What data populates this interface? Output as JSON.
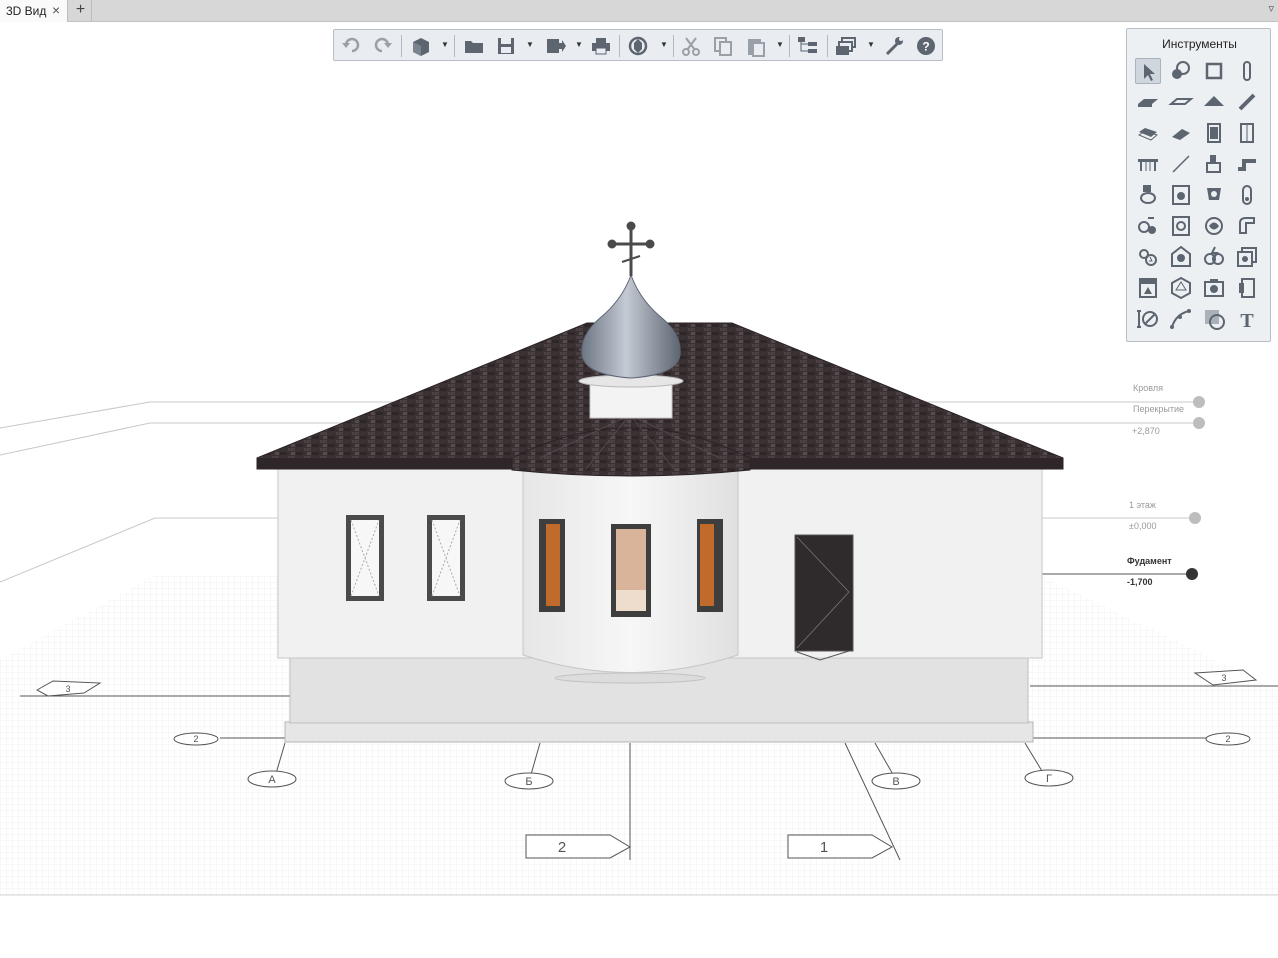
{
  "tabs": [
    {
      "label": "3D Вид",
      "close": "×"
    }
  ],
  "tab_add": "+",
  "tab_menu_icon": "triangle-down-icon",
  "toolbar": {
    "buttons": [
      {
        "name": "undo-button",
        "icon": "undo-icon"
      },
      {
        "name": "redo-button",
        "icon": "redo-icon"
      },
      {
        "name": "3d-view-button",
        "icon": "cube-icon"
      },
      {
        "name": "open-button",
        "icon": "folder-icon"
      },
      {
        "name": "save-button",
        "icon": "save-icon"
      },
      {
        "name": "export-button",
        "icon": "export-icon"
      },
      {
        "name": "print-button",
        "icon": "printer-icon"
      },
      {
        "name": "rotate-button",
        "icon": "rotate-icon"
      },
      {
        "name": "cut-button",
        "icon": "scissors-icon"
      },
      {
        "name": "copy-button",
        "icon": "copy-icon"
      },
      {
        "name": "paste-button",
        "icon": "paste-icon"
      },
      {
        "name": "object-tree-button",
        "icon": "tree-icon"
      },
      {
        "name": "layers-button",
        "icon": "layers-icon"
      },
      {
        "name": "settings-button",
        "icon": "wrench-icon"
      },
      {
        "name": "help-button",
        "icon": "help-icon"
      }
    ]
  },
  "tools_panel": {
    "title": "Инструменты",
    "tools": [
      "select-icon",
      "annotation-icon",
      "room-icon",
      "column-icon",
      "slab-icon",
      "floor-icon",
      "roof-icon",
      "beam-icon",
      "stairs-icon",
      "ramp-icon",
      "door-icon",
      "window-icon",
      "table-icon",
      "line-icon",
      "plumbing-icon",
      "pipe-icon",
      "toilet-icon",
      "washing-machine-icon",
      "heater-icon",
      "radiator-icon",
      "water-supply-icon",
      "boiler-icon",
      "ventilation-icon",
      "duct-icon",
      "electrical-icon",
      "lamp-icon",
      "socket-icon",
      "switch-panel-icon",
      "cabinet-icon",
      "3d-object-icon",
      "camera-icon",
      "panel-icon",
      "dimension-icon",
      "curve-icon",
      "hatch-icon",
      "text-icon"
    ]
  },
  "levels": [
    {
      "name": "Кровля",
      "value": ""
    },
    {
      "name": "Перекрытие",
      "value": "+2,870"
    },
    {
      "name": "1 этаж",
      "value": "±0,000"
    },
    {
      "name": "Фудамент",
      "value": "-1,700"
    }
  ],
  "axes": {
    "letters": [
      "А",
      "Б",
      "В",
      "Г"
    ],
    "numbers_bottom": [
      "2",
      "1"
    ],
    "side_left": [
      "3",
      "2"
    ],
    "side_right": [
      "3",
      "2"
    ]
  },
  "colors": {
    "roof": "#3a3133",
    "wall": "#f0f0f0",
    "plinth": "#e2e2e2",
    "dome": "#8f98a6",
    "grid": "#dcdcdc"
  }
}
